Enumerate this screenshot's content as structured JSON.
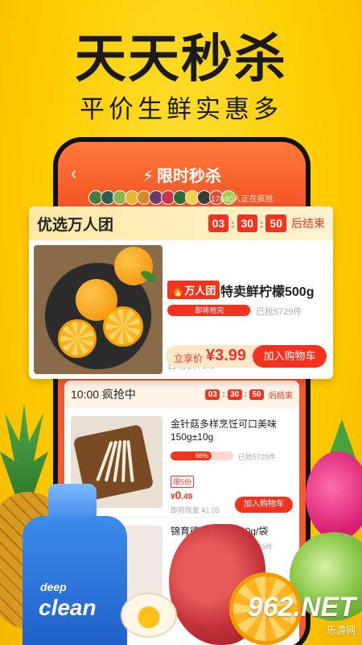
{
  "hero": {
    "title": "天天秒杀",
    "subtitle": "平价生鲜实惠多"
  },
  "app": {
    "header_title": "限时秒杀",
    "grabbing_text": "17640人正在疯抢"
  },
  "featured": {
    "section_title": "优选万人团",
    "timer": {
      "h": "03",
      "m": "30",
      "s": "50",
      "suffix": "后结束"
    },
    "tag": "万人团",
    "product_name": "特卖鲜柠檬500g",
    "progress_label": "即将抢完",
    "progress_fraction": 0.98,
    "sold_text": "已抢5729件",
    "original_price": "日常价¥5.8",
    "price_label": "立享价",
    "price": "¥3.99",
    "add_button": "加入购物车"
  },
  "list": {
    "session_title": "10:00 疯抢中",
    "timer": {
      "h": "03",
      "m": "30",
      "s": "50",
      "suffix": "后结束"
    },
    "items": [
      {
        "name": "金针菇多样烹饪可口美味150g±10g",
        "progress_label": "66%",
        "progress_fraction": 0.66,
        "sold_text": "已抢5729件",
        "limit": "限5份",
        "price_symbol": "¥",
        "price_int": "0",
        "price_dec": ".49",
        "restore_text": "即将恢复 ¥1.05",
        "add_button": "加入购物车"
      },
      {
        "name": "锦育德",
        "name_tail": "500g/袋",
        "sold_text": "8979件"
      }
    ]
  },
  "decor": {
    "bottle_line1": "deep",
    "bottle_line2": "clean"
  },
  "watermark": {
    "main": "962.NET",
    "sub": "乐游网"
  },
  "colors": {
    "background": "#FFD21A",
    "accent": "#F2331F",
    "header": "#F0471F"
  }
}
